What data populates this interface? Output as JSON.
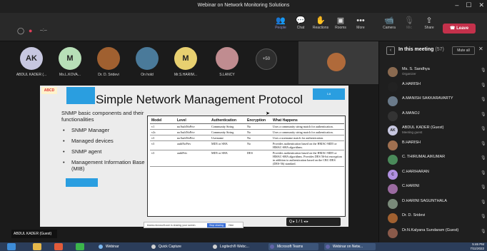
{
  "window": {
    "title": "Webinar on Network Monitoring Solutions",
    "controls": [
      "–",
      "☐",
      "✕"
    ]
  },
  "toolbar": {
    "meeting_timer": "–:–",
    "buttons": [
      {
        "label": "People",
        "icon": "people-icon"
      },
      {
        "label": "Chat",
        "icon": "chat-icon"
      },
      {
        "label": "Reactions",
        "icon": "reactions-icon"
      },
      {
        "label": "Rooms",
        "icon": "rooms-icon"
      },
      {
        "label": "More",
        "icon": "more-icon"
      },
      {
        "label": "Camera",
        "icon": "camera-icon"
      },
      {
        "label": "Mic",
        "icon": "mic-icon"
      },
      {
        "label": "Share",
        "icon": "share-icon"
      }
    ],
    "leave_label": "Leave",
    "colors": {
      "leave": "#c4314b",
      "active": "#8b8cc7"
    }
  },
  "participants_strip": [
    {
      "name": "ABDUL KADER (...",
      "initials": "AK",
      "color": "#c7c7e0",
      "photo": false
    },
    {
      "name": "Ms.L.KOVA...",
      "initials": "M",
      "color": "#b7dfb7",
      "photo": false
    },
    {
      "name": "Dr. D. Sridevi",
      "initials": "",
      "color": "#a06030",
      "photo": true
    },
    {
      "name": "On hold",
      "initials": "",
      "color": "#4a7a9a",
      "photo": true
    },
    {
      "name": "Mr.S.HARIM...",
      "initials": "M",
      "color": "#e8d070",
      "photo": false
    },
    {
      "name": "S.LANCY",
      "initials": "",
      "color": "#c08c90",
      "photo": true
    }
  ],
  "more_participants": "+50",
  "slide": {
    "logo": "ABCD",
    "title": "Simple Network Management Protocol",
    "slide_tag": "1.6",
    "intro": "SNMP basic components and their functionalities",
    "bullets": [
      "SNMP Manager",
      "Managed devices",
      "SNMP agent",
      "Management Information Base (MIB)"
    ],
    "table": {
      "headers": [
        "Model",
        "Level",
        "Authentication",
        "Encryption",
        "What Happens"
      ],
      "rows": [
        [
          "v1",
          "noAuthNoPriv",
          "Community String",
          "No",
          "Uses a community string match for authentication."
        ],
        [
          "v2c",
          "noAuthNoPriv",
          "Community String",
          "No",
          "Uses a community string match for authentication."
        ],
        [
          "v3",
          "noAuthNoPriv",
          "Username",
          "No",
          "Uses a username match for authentication."
        ],
        [
          "v3",
          "authNoPriv",
          "MD5 or SHA",
          "No",
          "Provides authentication based on the HMAC-MD5 or HMAC-SHA algorithms."
        ],
        [
          "v3",
          "authPriv",
          "MD5 or SHA",
          "DES",
          "Provides authentication based on the HMAC-MD5 or HMAC-SHA algorithms. Provides DES 56-bit encryption in addition to authentication based on the CBC-DES (DES-56) standard."
        ]
      ]
    },
    "share_notice": "teams.microsoft.com is sharing your screen.",
    "stop_sharing_label": "Stop sharing",
    "hide_label": "Hide",
    "zoom_text": "Q  ▸  1 / 1  ◂  ▸"
  },
  "presenter_label": "ABDUL KADER (Guest)",
  "sidebar": {
    "title": "In this meeting",
    "count": "(57)",
    "mute_all_label": "Mute all",
    "people": [
      {
        "name": "Ms. S. Sandhya",
        "sub": "Organizer",
        "initials": "",
        "color": "#8a6a50"
      },
      {
        "name": "A.HARISH",
        "sub": "",
        "initials": "",
        "color": "#222222"
      },
      {
        "name": "A.MANISH SAKKARAVARTY",
        "sub": "",
        "initials": "",
        "color": "#6a7a8a"
      },
      {
        "name": "A.MANOJ",
        "sub": "",
        "initials": "",
        "color": "#333333"
      },
      {
        "name": "ABDUL KADER (Guest)",
        "sub": "Meeting guest",
        "initials": "AK",
        "color": "#c7c7e0"
      },
      {
        "name": "B.HARISH",
        "sub": "",
        "initials": "",
        "color": "#a07050"
      },
      {
        "name": "C. THIRUMALAIKUMAR",
        "sub": "",
        "initials": "",
        "color": "#4a8a5a"
      },
      {
        "name": "C.HARIHARAN",
        "sub": "",
        "initials": "C",
        "color": "#b090e0"
      },
      {
        "name": "C.HARINI",
        "sub": "",
        "initials": "",
        "color": "#9a6aa0"
      },
      {
        "name": "D.HARINI SAGUNTHALA",
        "sub": "",
        "initials": "",
        "color": "#7a8a7a"
      },
      {
        "name": "Dr. D. Sridevi",
        "sub": "",
        "initials": "",
        "color": "#a06030"
      },
      {
        "name": "Dr.N.Kalyana Sundaram (Guest)",
        "sub": "",
        "initials": "",
        "color": "#8a5a4a"
      }
    ]
  },
  "taskbar": {
    "items": [
      "Webinar",
      "Quick Capture",
      "Logitech® Webc...",
      "Microsoft Teams",
      "Webinar on Netw..."
    ],
    "time": "5:46 PM",
    "date": "7/11/2022"
  }
}
